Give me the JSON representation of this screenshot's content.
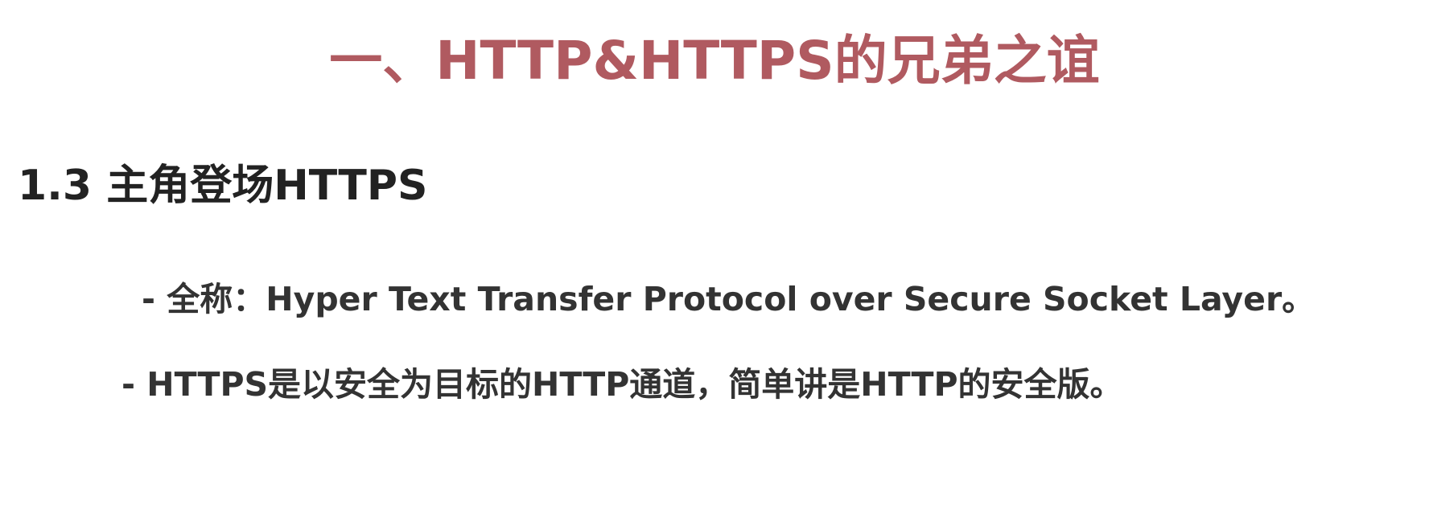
{
  "slide": {
    "title": "一、HTTP&HTTPS的兄弟之谊",
    "title_color": "#b05a60",
    "section_heading": "1.3 主角登场HTTPS",
    "bullets": [
      "- 全称：Hyper Text Transfer Protocol over Secure Socket Layer。",
      "- HTTPS是以安全为目标的HTTP通道，简单讲是HTTP的安全版。"
    ]
  }
}
